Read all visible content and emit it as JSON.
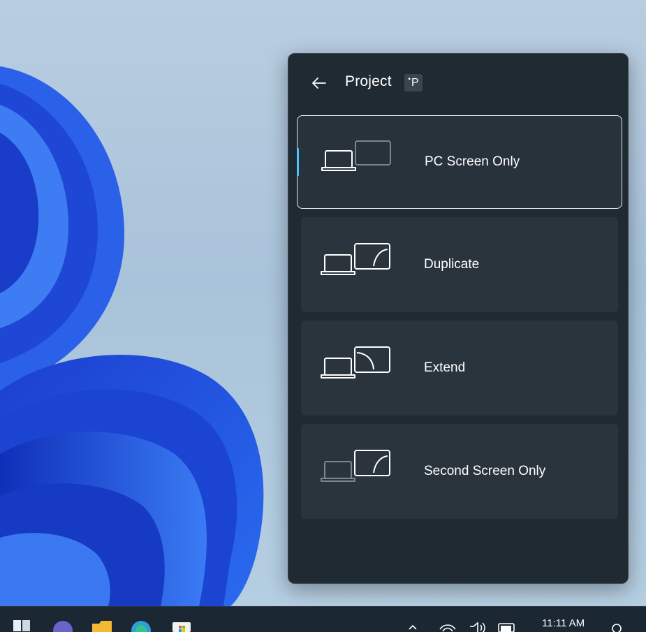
{
  "panel": {
    "title": "Project",
    "shortcut": "P",
    "shortcut_modifier": "windows-key-icon"
  },
  "options": [
    {
      "label": "PC Screen Only",
      "icon": "pc-screen-only-icon",
      "selected": true
    },
    {
      "label": "Duplicate",
      "icon": "duplicate-icon",
      "selected": false
    },
    {
      "label": "Extend",
      "icon": "extend-icon",
      "selected": false
    },
    {
      "label": "Second Screen Only",
      "icon": "second-screen-only-icon",
      "selected": false
    }
  ],
  "taskbar": {
    "time": "11:11 AM",
    "apps": [
      "start-icon",
      "teams-icon",
      "file-explorer-icon",
      "edge-icon",
      "store-icon"
    ],
    "tray": [
      "chevron-up-icon",
      "wifi-icon",
      "volume-icon",
      "battery-icon",
      "notifications-icon"
    ]
  },
  "colors": {
    "panel_bg": "#202a33",
    "option_bg": "#2a343d",
    "accent": "#4cc2ff",
    "wallpaper_blue": "#1f52e0"
  }
}
